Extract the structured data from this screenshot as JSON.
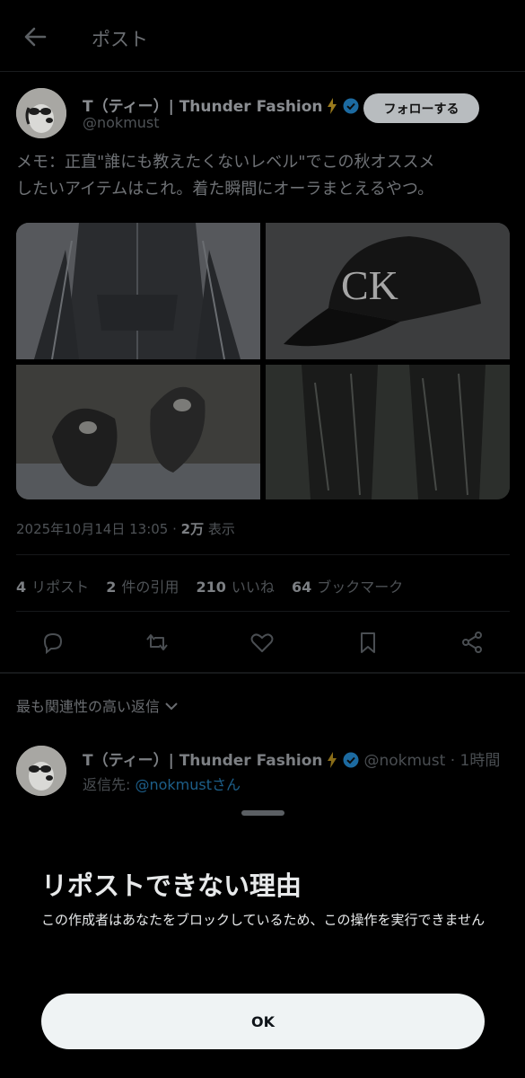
{
  "header": {
    "title": "ポスト"
  },
  "author": {
    "name": "T（ティー）| Thunder Fashion",
    "handle": "@nokmust",
    "follow_label": "フォローする"
  },
  "tweet": {
    "lines": [
      "メモ：正直\"誰にも教えたくないレベル\"でこの秋オススメ",
      "したいアイテムはこれ。着た瞬間にオーラまとえるやつ。"
    ]
  },
  "meta": {
    "date": "2025年10月14日 13:05",
    "sep": " · ",
    "views": "2万",
    "views_label": " 表示"
  },
  "stats": {
    "reposts": "4",
    "reposts_label": "リポスト",
    "quotes": "2",
    "quotes_label": "件の引用",
    "likes": "210",
    "likes_label": "いいね",
    "bookmarks": "64",
    "bookmarks_label": "ブックマーク"
  },
  "sort_label": "最も関連性の高い返信",
  "reply": {
    "name": "T（ティー）| Thunder Fashion",
    "handle_time": "@nokmust · 1時間",
    "reply_to_prefix": "返信先: ",
    "reply_to_handle": "@nokmustさん"
  },
  "sheet": {
    "title": "リポストできない理由",
    "body": "この作成者はあなたをブロックしているため、この操作を実行できません",
    "ok_label": "OK"
  },
  "colors": {
    "verified": "#1d9bf0",
    "bolt": "#e0a800",
    "link": "#1d9bf0"
  }
}
